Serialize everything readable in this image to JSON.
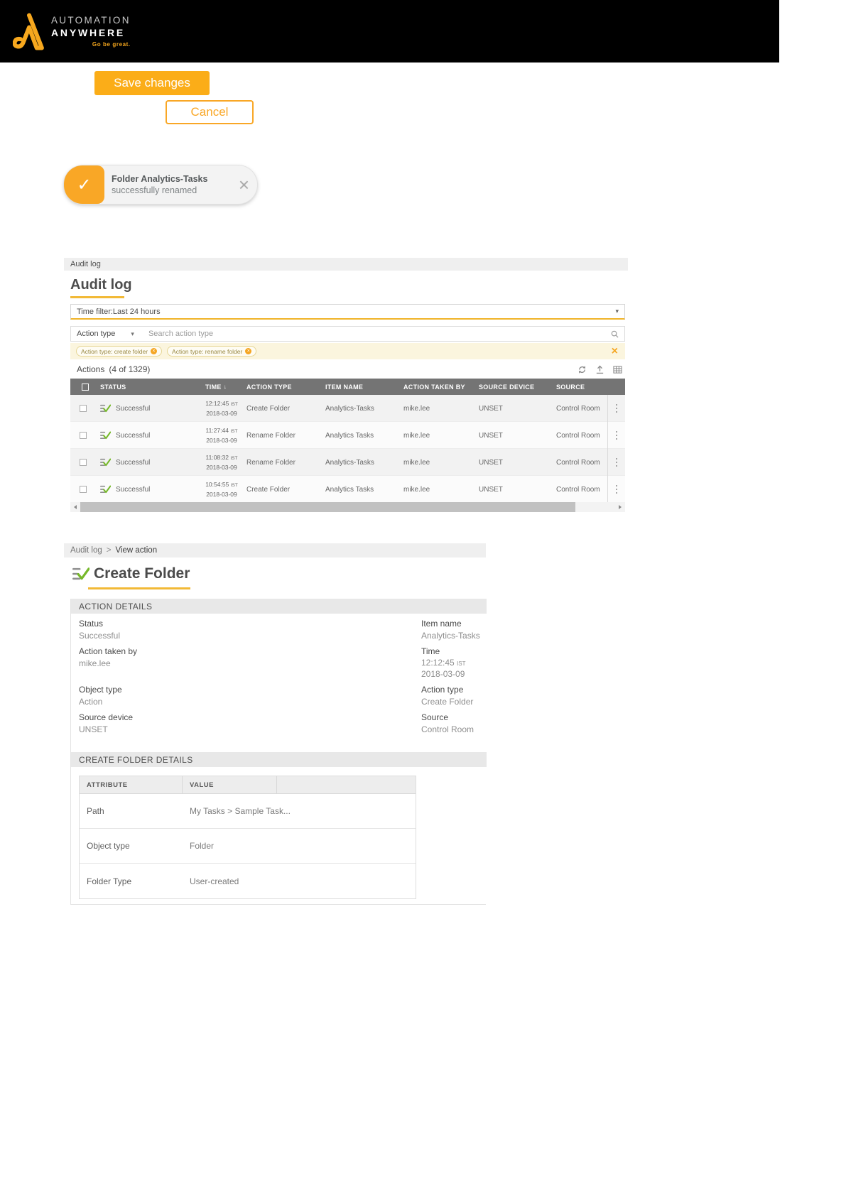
{
  "icons": {
    "check": "✓",
    "close": "×",
    "caret": "▾",
    "sort_desc": "↓",
    "chip_remove": "×",
    "clear_filters": "×",
    "breadcrumb_sep": ">"
  },
  "brand": {
    "line1": "AUTOMATION",
    "line2": "ANYWHERE",
    "tagline": "Go be great."
  },
  "buttons": {
    "save": "Save changes",
    "cancel": "Cancel"
  },
  "toast": {
    "title": "Folder Analytics-Tasks",
    "message": "successfully renamed"
  },
  "audit": {
    "breadcrumb": "Audit log",
    "title": "Audit log",
    "time_filter_value": "Time filter:Last 24 hours",
    "action_type_label": "Action type",
    "search_placeholder": "Search action type",
    "chips": [
      {
        "label": "Action type: create folder"
      },
      {
        "label": "Action type: rename folder"
      }
    ],
    "actions_label": "Actions",
    "actions_count": "(4 of 1329)",
    "columns": {
      "status": "STATUS",
      "time": "TIME",
      "action_type": "ACTION TYPE",
      "item_name": "ITEM NAME",
      "action_taken_by": "ACTION TAKEN BY",
      "source_device": "SOURCE DEVICE",
      "source": "SOURCE"
    },
    "rows": [
      {
        "status": "Successful",
        "time": "12:12:45",
        "tz": "IST",
        "date": "2018-03-09",
        "action_type": "Create Folder",
        "item_name": "Analytics-Tasks",
        "taken_by": "mike.lee",
        "device": "UNSET",
        "source": "Control Room"
      },
      {
        "status": "Successful",
        "time": "11:27:44",
        "tz": "IST",
        "date": "2018-03-09",
        "action_type": "Rename Folder",
        "item_name": "Analytics Tasks",
        "taken_by": "mike.lee",
        "device": "UNSET",
        "source": "Control Room"
      },
      {
        "status": "Successful",
        "time": "11:08:32",
        "tz": "IST",
        "date": "2018-03-09",
        "action_type": "Rename Folder",
        "item_name": "Analytics-Tasks",
        "taken_by": "mike.lee",
        "device": "UNSET",
        "source": "Control Room"
      },
      {
        "status": "Successful",
        "time": "10:54:55",
        "tz": "IST",
        "date": "2018-03-09",
        "action_type": "Create Folder",
        "item_name": "Analytics Tasks",
        "taken_by": "mike.lee",
        "device": "UNSET",
        "source": "Control Room"
      }
    ]
  },
  "view_action": {
    "breadcrumb_parent": "Audit log",
    "breadcrumb_current": "View action",
    "title": "Create Folder",
    "action_details_title": "ACTION DETAILS",
    "fields": {
      "status_label": "Status",
      "status_value": "Successful",
      "item_label": "Item name",
      "item_value": "Analytics-Tasks",
      "taken_label": "Action taken by",
      "taken_value": "mike.lee",
      "time_label": "Time",
      "time_value": "12:12:45",
      "time_tz": "IST",
      "time_date": "2018-03-09",
      "object_label": "Object type",
      "object_value": "Action",
      "atype_label": "Action type",
      "atype_value": "Create Folder",
      "device_label": "Source device",
      "device_value": "UNSET",
      "source_label": "Source",
      "source_value": "Control Room"
    },
    "folder_details_title": "CREATE FOLDER DETAILS",
    "table": {
      "col_attribute": "ATTRIBUTE",
      "col_value": "VALUE",
      "rows": [
        {
          "attribute": "Path",
          "value": "My Tasks > Sample Task..."
        },
        {
          "attribute": "Object type",
          "value": "Folder"
        },
        {
          "attribute": "Folder Type",
          "value": "User-created"
        }
      ]
    }
  },
  "colors": {
    "accent_orange": "#F9A726",
    "accent_yellow": "#F2B936",
    "success_green": "#76B82A",
    "header_gray": "#747474"
  }
}
